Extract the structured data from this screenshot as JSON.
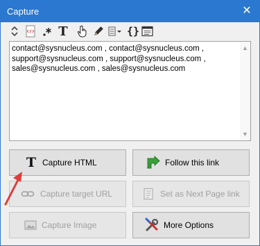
{
  "window": {
    "title": "Capture",
    "close_glyph": "✕"
  },
  "toolbar": {
    "icons": [
      "expand-icon",
      "html-code-icon",
      "regex-icon",
      "text-icon",
      "hand-cursor-icon",
      "pencil-icon",
      "column-dropdown-icon",
      "braces-icon",
      "window-icon"
    ],
    "braces_glyph": "{}",
    "text_glyph": "T"
  },
  "capture_text": {
    "lines": [
      "contact@sysnucleus.com , contact@sysnucleus.com ,",
      "support@sysnucleus.com , support@sysnucleus.com ,",
      "sales@sysnucleus.com , sales@sysnucleus.com"
    ]
  },
  "buttons": {
    "capture_html": "Capture HTML",
    "follow_link": "Follow this link",
    "capture_target_url": "Capture target URL",
    "set_next_page": "Set as Next Page link",
    "capture_image": "Capture Image",
    "more_options": "More Options"
  },
  "colors": {
    "titlebar": "#2b78d0",
    "annotation_arrow": "#e03c3c"
  }
}
